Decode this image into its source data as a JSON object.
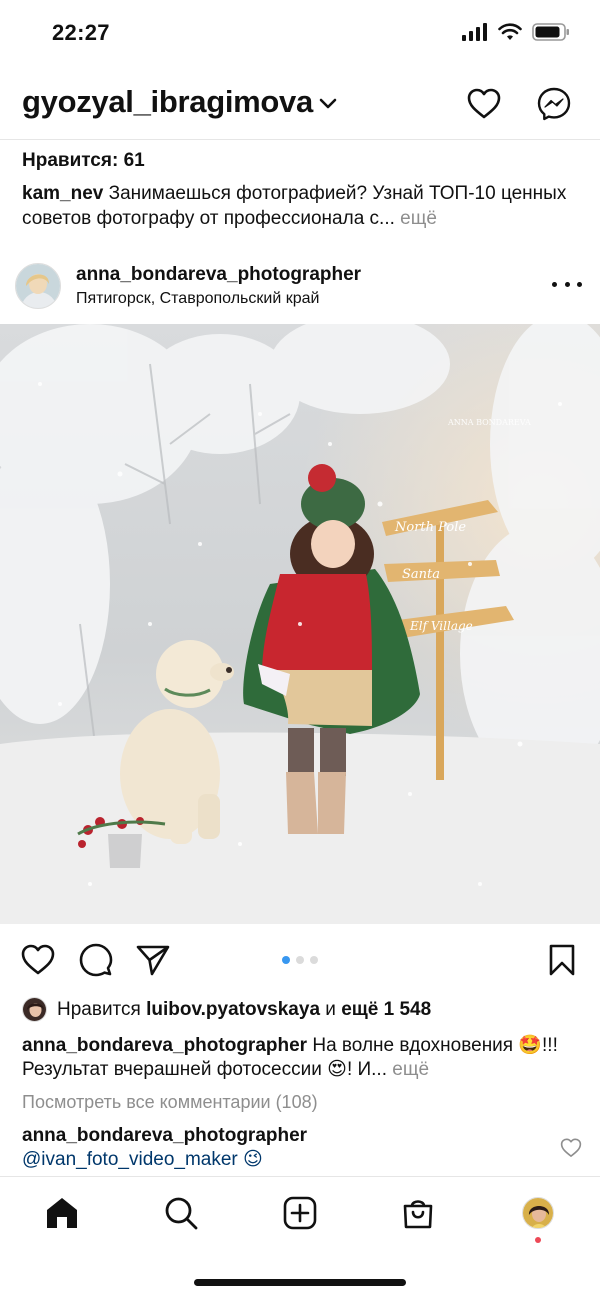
{
  "status_bar": {
    "time": "22:27",
    "icons": [
      "signal-icon",
      "wifi-icon",
      "battery-icon"
    ]
  },
  "header": {
    "username": "gyozyal_ibragimova",
    "icons": [
      "chevron-down-icon",
      "heart-icon",
      "messenger-icon"
    ]
  },
  "previous_post": {
    "likes_text": "Нравится: 61",
    "caption_user": "kam_nev",
    "caption_text": "Занимаешься фотографией? Узнай ТОП-10 ценных советов фотографу от профессионала с...",
    "more_label": "ещё"
  },
  "post": {
    "username": "anna_bondareva_photographer",
    "location": "Пятигорск, Ставропольский край",
    "image_alt": "ANNA BONDAREVA",
    "sign_texts": [
      "North Pole",
      "Santa",
      "Elf Village"
    ],
    "carousel": {
      "count": 3,
      "active_index": 0
    },
    "likes_prefix": "Нравится",
    "liked_by": "luibov.pyatovskaya",
    "likes_conj": "и",
    "likes_more": "ещё 1 548",
    "caption_user": "anna_bondareva_photographer",
    "caption_text": "На волне вдохновения 🤩!!! Результат вчерашней фотосессии 😍! И...",
    "caption_more": "ещё",
    "view_comments": "Посмотреть все комментарии (108)",
    "comment_user": "anna_bondareva_photographer",
    "comment_text": "@ivan_foto_video_maker 😉"
  },
  "tab_bar": {
    "items": [
      "home-icon",
      "search-icon",
      "add-post-icon",
      "shop-icon",
      "profile-avatar"
    ]
  },
  "colors": {
    "accent": "#3897f0",
    "muted": "#8e8e8e",
    "notification": "#ed4956",
    "mention": "#00376b"
  }
}
